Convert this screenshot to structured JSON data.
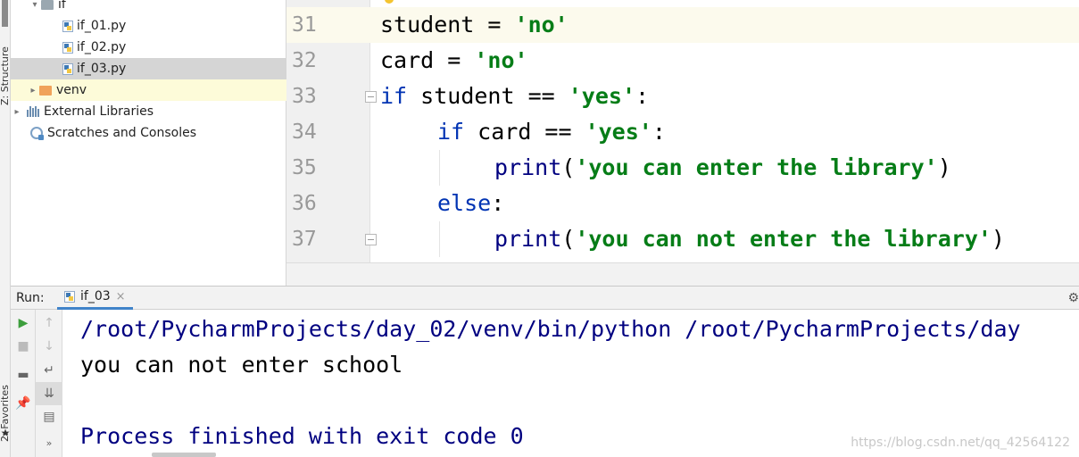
{
  "sidebar_tabs": {
    "structure": "Z: Structure",
    "favorites": "2: Favorites"
  },
  "project_tree": [
    {
      "label": "if",
      "type": "folder"
    },
    {
      "label": "if_01.py",
      "type": "file"
    },
    {
      "label": "if_02.py",
      "type": "file"
    },
    {
      "label": "if_03.py",
      "type": "file",
      "selected": true
    },
    {
      "label": "venv",
      "type": "folder-excluded"
    },
    {
      "label": "External Libraries",
      "type": "library"
    },
    {
      "label": "Scratches and Consoles",
      "type": "scratch"
    }
  ],
  "editor": {
    "lines": [
      {
        "num": "31",
        "current": true
      },
      {
        "num": "32"
      },
      {
        "num": "33"
      },
      {
        "num": "34"
      },
      {
        "num": "35"
      },
      {
        "num": "36"
      },
      {
        "num": "37"
      }
    ],
    "tokens": {
      "l31_a": "student = ",
      "l31_b": "'no'",
      "l32_a": "card = ",
      "l32_b": "'no'",
      "l33_kw": "if",
      "l33_a": " student == ",
      "l33_b": "'yes'",
      "l33_c": ":",
      "l34_kw": "if",
      "l34_a": " card == ",
      "l34_b": "'yes'",
      "l34_c": ":",
      "l35_fn": "print",
      "l35_a": "(",
      "l35_b": "'you can enter the library'",
      "l35_c": ")",
      "l36_kw": "else",
      "l36_c": ":",
      "l37_fn": "print",
      "l37_a": "(",
      "l37_b": "'you can not enter the library'",
      "l37_c": ")"
    }
  },
  "run_panel": {
    "label": "Run:",
    "tab": "if_03",
    "close_glyph": "×",
    "output": [
      "/root/PycharmProjects/day_02/venv/bin/python /root/PycharmProjects/day",
      "you can not enter school",
      "",
      "Process finished with exit code 0"
    ]
  },
  "watermark": "https://blog.csdn.net/qq_42564122",
  "icons": [
    "play-icon",
    "stop-icon",
    "layout-icon",
    "pin-icon",
    "up-arrow-icon",
    "down-arrow-icon",
    "soft-wrap-icon",
    "scroll-to-end-icon",
    "print-icon",
    "more-icon",
    "gear-icon"
  ]
}
